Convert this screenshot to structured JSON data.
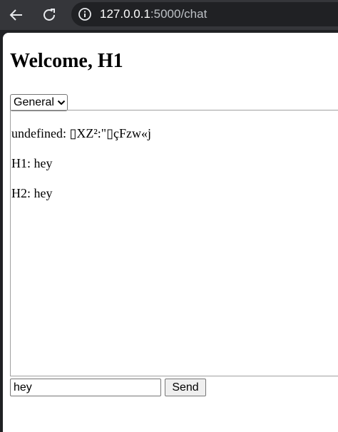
{
  "browser": {
    "url_host": "127.0.0.1",
    "url_rest": ":5000/chat",
    "icons": {
      "back": "back-arrow-icon",
      "reload": "reload-icon",
      "site_info": "info-icon"
    }
  },
  "page": {
    "title": "Welcome, H1",
    "room_select": {
      "selected": "General"
    },
    "messages": [
      {
        "text": "undefined: ▯XZ²:\"▯çFzw«j"
      },
      {
        "text": "H1: hey"
      },
      {
        "text": "H2: hey"
      }
    ],
    "input": {
      "value": "hey"
    },
    "send_label": "Send"
  }
}
